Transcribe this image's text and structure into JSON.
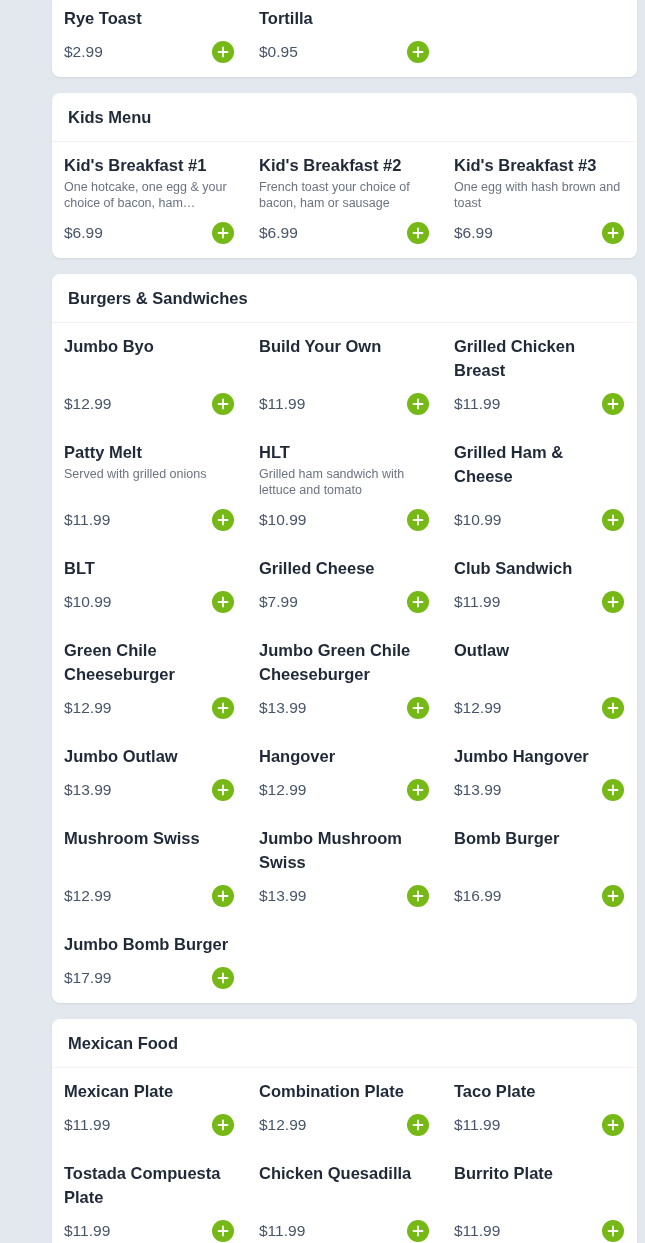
{
  "sections": [
    {
      "items": [
        {
          "name": "Rye Toast",
          "price": "$2.99"
        },
        {
          "name": "Tortilla",
          "price": "$0.95"
        }
      ]
    },
    {
      "title": "Kids Menu",
      "items": [
        {
          "name": "Kid's Breakfast #1",
          "description": "One hotcake, one egg & your choice of bacon, ham…",
          "price": "$6.99"
        },
        {
          "name": "Kid's Breakfast #2",
          "description": "French toast your choice of bacon, ham or sausage",
          "price": "$6.99"
        },
        {
          "name": "Kid's Breakfast #3",
          "description": "One egg with hash brown and toast",
          "price": "$6.99"
        }
      ]
    },
    {
      "title": "Burgers & Sandwiches",
      "items": [
        {
          "name": "Jumbo Byo",
          "price": "$12.99"
        },
        {
          "name": "Build Your Own",
          "price": "$11.99"
        },
        {
          "name": "Grilled Chicken Breast",
          "price": "$11.99"
        },
        {
          "name": "Patty Melt",
          "description": "Served with grilled onions",
          "price": "$11.99"
        },
        {
          "name": "HLT",
          "description": "Grilled ham sandwich with lettuce and tomato",
          "price": "$10.99"
        },
        {
          "name": "Grilled Ham & Cheese",
          "price": "$10.99"
        },
        {
          "name": "BLT",
          "price": "$10.99"
        },
        {
          "name": "Grilled Cheese",
          "price": "$7.99"
        },
        {
          "name": "Club Sandwich",
          "price": "$11.99"
        },
        {
          "name": "Green Chile Cheeseburger",
          "price": "$12.99"
        },
        {
          "name": "Jumbo Green Chile Cheeseburger",
          "price": "$13.99"
        },
        {
          "name": "Outlaw",
          "price": "$12.99"
        },
        {
          "name": "Jumbo Outlaw",
          "price": "$13.99"
        },
        {
          "name": "Hangover",
          "price": "$12.99"
        },
        {
          "name": "Jumbo Hangover",
          "price": "$13.99"
        },
        {
          "name": "Mushroom Swiss",
          "price": "$12.99"
        },
        {
          "name": "Jumbo Mushroom Swiss",
          "price": "$13.99"
        },
        {
          "name": "Bomb Burger",
          "price": "$16.99"
        },
        {
          "name": "Jumbo Bomb Burger",
          "price": "$17.99"
        }
      ]
    },
    {
      "title": "Mexican Food",
      "items": [
        {
          "name": "Mexican Plate",
          "price": "$11.99"
        },
        {
          "name": "Combination Plate",
          "price": "$12.99"
        },
        {
          "name": "Taco Plate",
          "price": "$11.99"
        },
        {
          "name": "Tostada Compuesta Plate",
          "price": "$11.99"
        },
        {
          "name": "Chicken Quesadilla",
          "price": "$11.99"
        },
        {
          "name": "Burrito Plate",
          "price": "$11.99"
        }
      ]
    }
  ]
}
